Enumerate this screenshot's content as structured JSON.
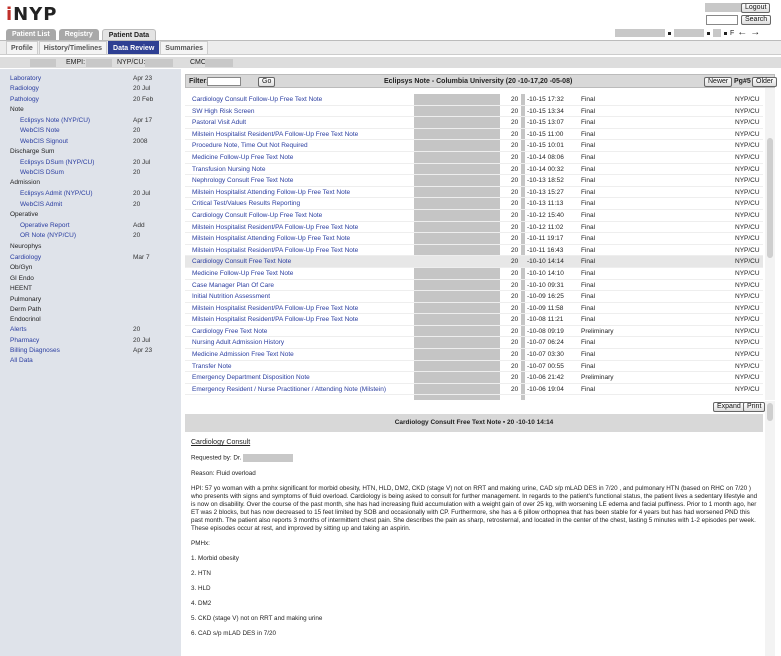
{
  "app": {
    "logo": "iNYP"
  },
  "header": {
    "logout_label": "Logout",
    "search_label": "Search",
    "patient_suffix": "F"
  },
  "tabs": [
    "Patient List",
    "Registry",
    "Patient Data"
  ],
  "subtabs": [
    "Profile",
    "History/Timelines",
    "Data Review",
    "Summaries"
  ],
  "id_bar": {
    "empi_label": "EMPI:",
    "nypcu_label": "NYP/CU:",
    "cmc_label": "CMC:"
  },
  "sidebar": [
    {
      "label": "Laboratory",
      "date": "Apr 23",
      "type": "link"
    },
    {
      "label": "Radiology",
      "date": "20   Jul",
      "type": "link"
    },
    {
      "label": "Pathology",
      "date": "20   Feb",
      "type": "link"
    },
    {
      "label": "Note",
      "date": "",
      "type": "hdr"
    },
    {
      "label": "Eclipsys Note (NYP/CU)",
      "date": "Apr 17",
      "type": "sub"
    },
    {
      "label": "WebCIS Note",
      "date": "20",
      "type": "sub"
    },
    {
      "label": "WebCIS Signout",
      "date": "2008",
      "type": "sub"
    },
    {
      "label": "Discharge Sum",
      "date": "",
      "type": "hdr"
    },
    {
      "label": "Eclipsys DSum (NYP/CU)",
      "date": "20   Jul",
      "type": "sub"
    },
    {
      "label": "WebCIS DSum",
      "date": "20",
      "type": "sub"
    },
    {
      "label": "Admission",
      "date": "",
      "type": "hdr"
    },
    {
      "label": "Eclipsys Admit (NYP/CU)",
      "date": "20   Jul",
      "type": "sub"
    },
    {
      "label": "WebCIS Admit",
      "date": "20",
      "type": "sub"
    },
    {
      "label": "Operative",
      "date": "",
      "type": "hdr"
    },
    {
      "label": "Operative Report",
      "date": "Add",
      "type": "sub"
    },
    {
      "label": "OR Note (NYP/CU)",
      "date": "20",
      "type": "sub"
    },
    {
      "label": "Neurophys",
      "date": "",
      "type": "hdr"
    },
    {
      "label": "Cardiology",
      "date": "Mar 7",
      "type": "link"
    },
    {
      "label": "Ob/Gyn",
      "date": "",
      "type": "hdr"
    },
    {
      "label": "GI Endo",
      "date": "",
      "type": "hdr"
    },
    {
      "label": "HEENT",
      "date": "",
      "type": "hdr"
    },
    {
      "label": "Pulmonary",
      "date": "",
      "type": "hdr"
    },
    {
      "label": "Derm Path",
      "date": "",
      "type": "hdr"
    },
    {
      "label": "Endocrinol",
      "date": "",
      "type": "hdr"
    },
    {
      "label": "Alerts",
      "date": "20",
      "type": "link"
    },
    {
      "label": "Pharmacy",
      "date": "20   Jul",
      "type": "link"
    },
    {
      "label": "Billing Diagnoses",
      "date": "Apr 23",
      "type": "link"
    },
    {
      "label": "All Data",
      "date": "",
      "type": "link"
    }
  ],
  "filter_bar": {
    "filter_label": "Filter:",
    "go_label": "Go",
    "title": "Eclipsys Note - Columbia University (20   -10-17,20   -05-08)",
    "newer_label": "Newer",
    "page_label": "Pg#5",
    "older_label": "Older"
  },
  "notes": [
    {
      "title": "Cardiology Consult Follow-Up Free Text Note",
      "year": "20",
      "date": "-10-15 17:32",
      "status": "Final",
      "loc": "NYP/CU"
    },
    {
      "title": "SW High Risk Screen",
      "year": "20",
      "date": "-10-15 13:34",
      "status": "Final",
      "loc": "NYP/CU"
    },
    {
      "title": "Pastoral Visit Adult",
      "year": "20",
      "date": "-10-15 13:07",
      "status": "Final",
      "loc": "NYP/CU"
    },
    {
      "title": "Milstein Hospitalist Resident/PA Follow-Up Free Text Note",
      "year": "20",
      "date": "-10-15 11:00",
      "status": "Final",
      "loc": "NYP/CU"
    },
    {
      "title": "Procedure Note, Time Out Not Required",
      "year": "20",
      "date": "-10-15 10:01",
      "status": "Final",
      "loc": "NYP/CU"
    },
    {
      "title": "Medicine Follow-Up Free Text Note",
      "year": "20",
      "date": "-10-14 08:06",
      "status": "Final",
      "loc": "NYP/CU"
    },
    {
      "title": "Transfusion Nursing Note",
      "year": "20",
      "date": "-10-14 00:32",
      "status": "Final",
      "loc": "NYP/CU"
    },
    {
      "title": "Nephrology Consult Free Text Note",
      "year": "20",
      "date": "-10-13 18:52",
      "status": "Final",
      "loc": "NYP/CU"
    },
    {
      "title": "Milstein Hospitalist Attending Follow-Up Free Text Note",
      "year": "20",
      "date": "-10-13 15:27",
      "status": "Final",
      "loc": "NYP/CU"
    },
    {
      "title": "Critical Test/Values Results Reporting",
      "year": "20",
      "date": "-10-13 11:13",
      "status": "Final",
      "loc": "NYP/CU"
    },
    {
      "title": "Cardiology Consult Follow-Up Free Text Note",
      "year": "20",
      "date": "-10-12 15:40",
      "status": "Final",
      "loc": "NYP/CU"
    },
    {
      "title": "Milstein Hospitalist Resident/PA Follow-Up Free Text Note",
      "year": "20",
      "date": "-10-12 11:02",
      "status": "Final",
      "loc": "NYP/CU"
    },
    {
      "title": "Milstein Hospitalist Attending Follow-Up Free Text Note",
      "year": "20",
      "date": "-10-11 19:17",
      "status": "Final",
      "loc": "NYP/CU"
    },
    {
      "title": "Milstein Hospitalist Resident/PA Follow-Up Free Text Note",
      "year": "20",
      "date": "-10-11 16:43",
      "status": "Final",
      "loc": "NYP/CU"
    },
    {
      "title": "Cardiology Consult Free Text Note",
      "year": "20",
      "date": "-10-10 14:14",
      "status": "Final",
      "loc": "NYP/CU"
    },
    {
      "title": "Medicine Follow-Up Free Text Note",
      "year": "20",
      "date": "-10-10 14:10",
      "status": "Final",
      "loc": "NYP/CU"
    },
    {
      "title": "Case Manager Plan Of Care",
      "year": "20",
      "date": "-10-10 09:31",
      "status": "Final",
      "loc": "NYP/CU"
    },
    {
      "title": "Initial Nutrition Assessment",
      "year": "20",
      "date": "-10-09 16:25",
      "status": "Final",
      "loc": "NYP/CU"
    },
    {
      "title": "Milstein Hospitalist Resident/PA Follow-Up Free Text Note",
      "year": "20",
      "date": "-10-09 11:58",
      "status": "Final",
      "loc": "NYP/CU"
    },
    {
      "title": "Milstein Hospitalist Resident/PA Follow-Up Free Text Note",
      "year": "20",
      "date": "-10-08 11:21",
      "status": "Final",
      "loc": "NYP/CU"
    },
    {
      "title": "Cardiology Free Text Note",
      "year": "20",
      "date": "-10-08 09:19",
      "status": "Preliminary",
      "loc": "NYP/CU"
    },
    {
      "title": "Nursing Adult Admission History",
      "year": "20",
      "date": "-10-07 06:24",
      "status": "Final",
      "loc": "NYP/CU"
    },
    {
      "title": "Medicine Admission Free Text Note",
      "year": "20",
      "date": "-10-07 03:30",
      "status": "Final",
      "loc": "NYP/CU"
    },
    {
      "title": "Transfer Note",
      "year": "20",
      "date": "-10-07 00:55",
      "status": "Final",
      "loc": "NYP/CU"
    },
    {
      "title": "Emergency Department Disposition Note",
      "year": "20",
      "date": "-10-06 21:42",
      "status": "Preliminary",
      "loc": "NYP/CU"
    },
    {
      "title": "Emergency Resident / Nurse Practitioner / Attending Note (Milstein)",
      "year": "20",
      "date": "-10-06 19:04",
      "status": "Final",
      "loc": "NYP/CU"
    }
  ],
  "selected_note_index": 14,
  "note_view": {
    "expand_label": "Expand",
    "print_label": "Print",
    "header": "Cardiology Consult Free Text Note  ▪ 20   -10-10 14:14",
    "title": "Cardiology Consult",
    "requested_by": "Requested by: Dr.",
    "reason": "Reason: Fluid overload",
    "hpi": "HPI: 57 yo woman with a pmhx significant for morbid obesity, HTN, HLD, DM2, CKD (stage V) not on RRT and making urine, CAD s/p mLAD DES in 7/20    , and pulmonary HTN (based on RHC on 7/20    ) who presents with signs and symptoms of fluid overload. Cardiology is being asked to consult for further management. In regards to the patient's functional status, the patient lives a sedentary lifestyle and is now on disability. Over the course of the past month, she has had increasing fluid accumulation with a weight gain of over 25 kg, with worsening LE edema and facial puffiness. Prior to 1 month ago, her ET was 2 blocks, but has now decreased to 15 feet limited by SOB and occasionally with CP. Furthermore, she has a 6 pillow orthopnea that has been stable for 4 years but has had worsened PND this past month. The patient also reports 3 months of intermittent chest pain. She describes the pain as sharp, retrosternal, and located in the center of the chest, lasting 5 minutes with 1-2 episodes per week. These episodes occur at rest, and improved by sitting up and taking an aspirin.",
    "pmhx_label": "PMHx:",
    "pmhx": [
      "1. Morbid obesity",
      "2. HTN",
      "3. HLD",
      "4. DM2",
      "5. CKD (stage V) not on RRT and making urine",
      "6. CAD s/p mLAD DES in 7/20"
    ]
  },
  "colors": {
    "link": "#2a3da0",
    "active_subtab": "#2e3f93",
    "sidebar_bg": "#dfe3ea",
    "logo_accent": "#c0302a"
  }
}
